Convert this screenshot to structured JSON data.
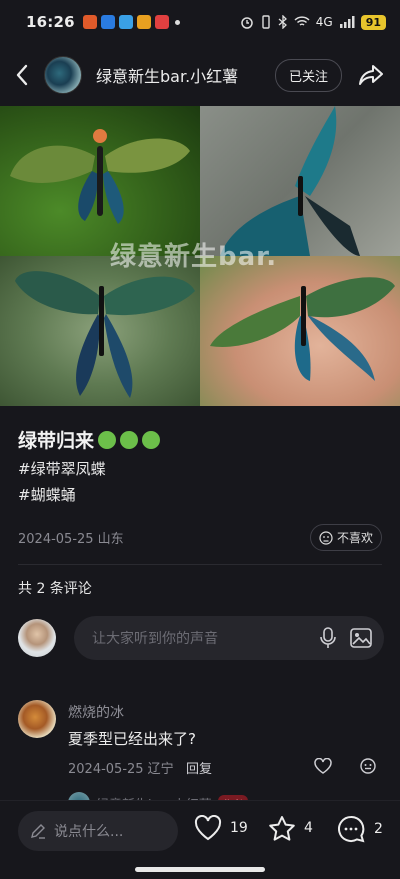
{
  "status_bar": {
    "time": "16:26",
    "network": "4G",
    "battery": "91"
  },
  "header": {
    "author": "绿意新生bar.小红薯",
    "follow_label": "已关注"
  },
  "images": {
    "watermark": "绿意新生bar."
  },
  "post": {
    "title": "绿带归来",
    "tags": [
      "#绿带翠凤蝶",
      "#蝴蝶蛹"
    ],
    "meta": "2024-05-25 山东",
    "dislike_label": "不喜欢"
  },
  "comments": {
    "count_label": "共 2 条评论",
    "input_placeholder": "让大家听到你的声音",
    "items": [
      {
        "author": "燃烧的冰",
        "text": "夏季型已经出来了?",
        "meta": "2024-05-25 辽宁",
        "reply_label": "回复"
      }
    ],
    "sub_peek_author": "绿意新生b... 小红薯",
    "sub_peek_badge": "作者"
  },
  "bottom_bar": {
    "say_placeholder": "说点什么...",
    "likes": "19",
    "collects": "4",
    "comments": "2"
  },
  "colors": {
    "background": "#17171c",
    "accent_green": "#6cbf4a",
    "battery": "#e8c52c"
  }
}
